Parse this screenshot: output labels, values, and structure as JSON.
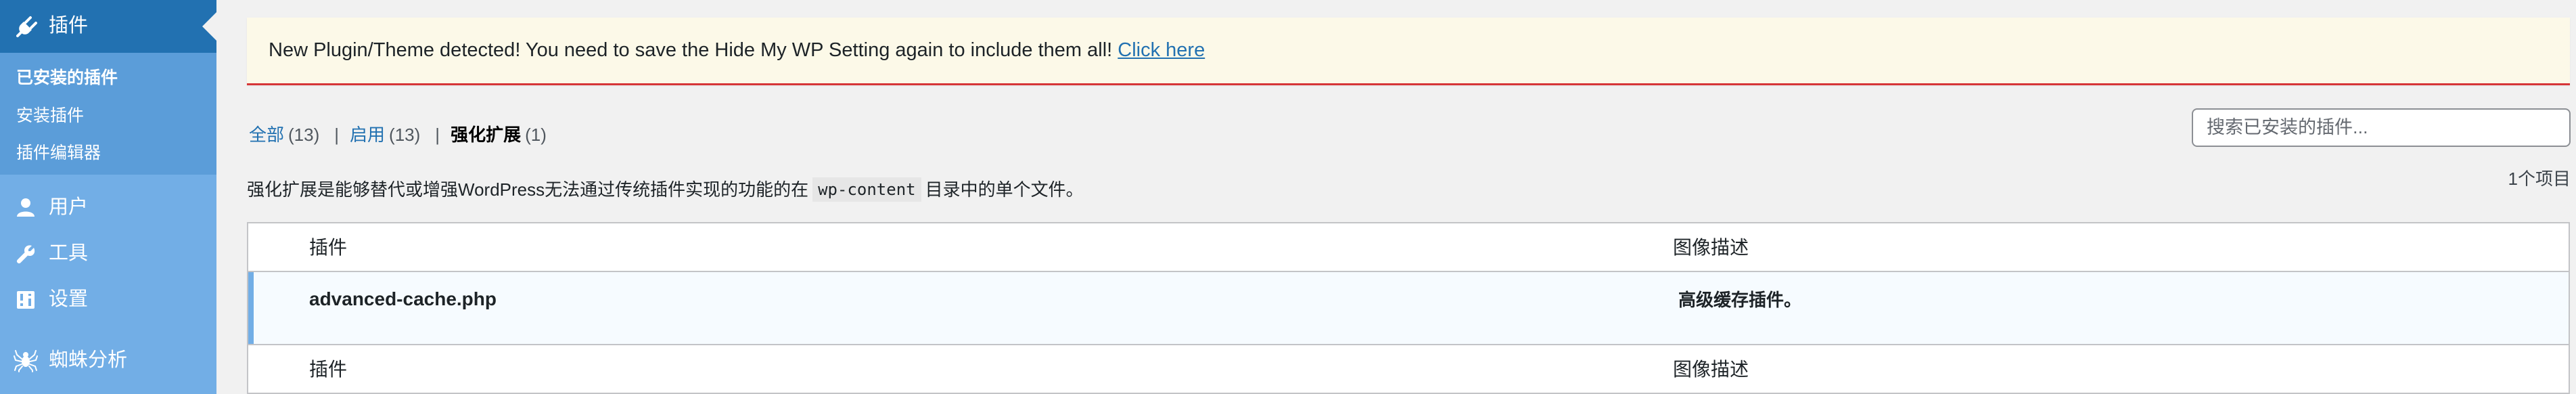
{
  "sidebar": {
    "current_menu": {
      "label": "插件",
      "icon": "plugin-icon"
    },
    "submenu": [
      {
        "label": "已安装的插件",
        "current": true
      },
      {
        "label": "安装插件"
      },
      {
        "label": "插件编辑器"
      }
    ],
    "menu": [
      {
        "label": "用户",
        "icon": "user-icon"
      },
      {
        "label": "工具",
        "icon": "wrench-icon"
      },
      {
        "label": "设置",
        "icon": "settings-icon"
      },
      {
        "label": "蜘蛛分析",
        "icon": "spider-icon"
      }
    ]
  },
  "notice": {
    "text": "New Plugin/Theme detected! You need to save the Hide My WP Setting again to include them all!",
    "link": "Click here"
  },
  "filters": [
    {
      "label": "全部",
      "count": "(13)"
    },
    {
      "label": "启用",
      "count": "(13)"
    },
    {
      "label": "强化扩展",
      "count": "(1)",
      "current": true
    }
  ],
  "search": {
    "placeholder": "搜索已安装的插件..."
  },
  "items_count": "1个项目",
  "description": {
    "before": "强化扩展是能够替代或增强WordPress无法通过传统插件实现的功能的在",
    "code": "wp-content",
    "after": "目录中的单个文件。"
  },
  "table": {
    "columns": [
      "插件",
      "图像描述"
    ],
    "rows": [
      {
        "plugin": "advanced-cache.php",
        "description": "高级缓存插件。"
      }
    ],
    "footer_columns": [
      "插件",
      "图像描述"
    ]
  },
  "colors": {
    "accent": "#2271b1",
    "sidebar": "#72aee6",
    "notice_bg": "#fcf9e8",
    "notice_border": "#d63638"
  }
}
